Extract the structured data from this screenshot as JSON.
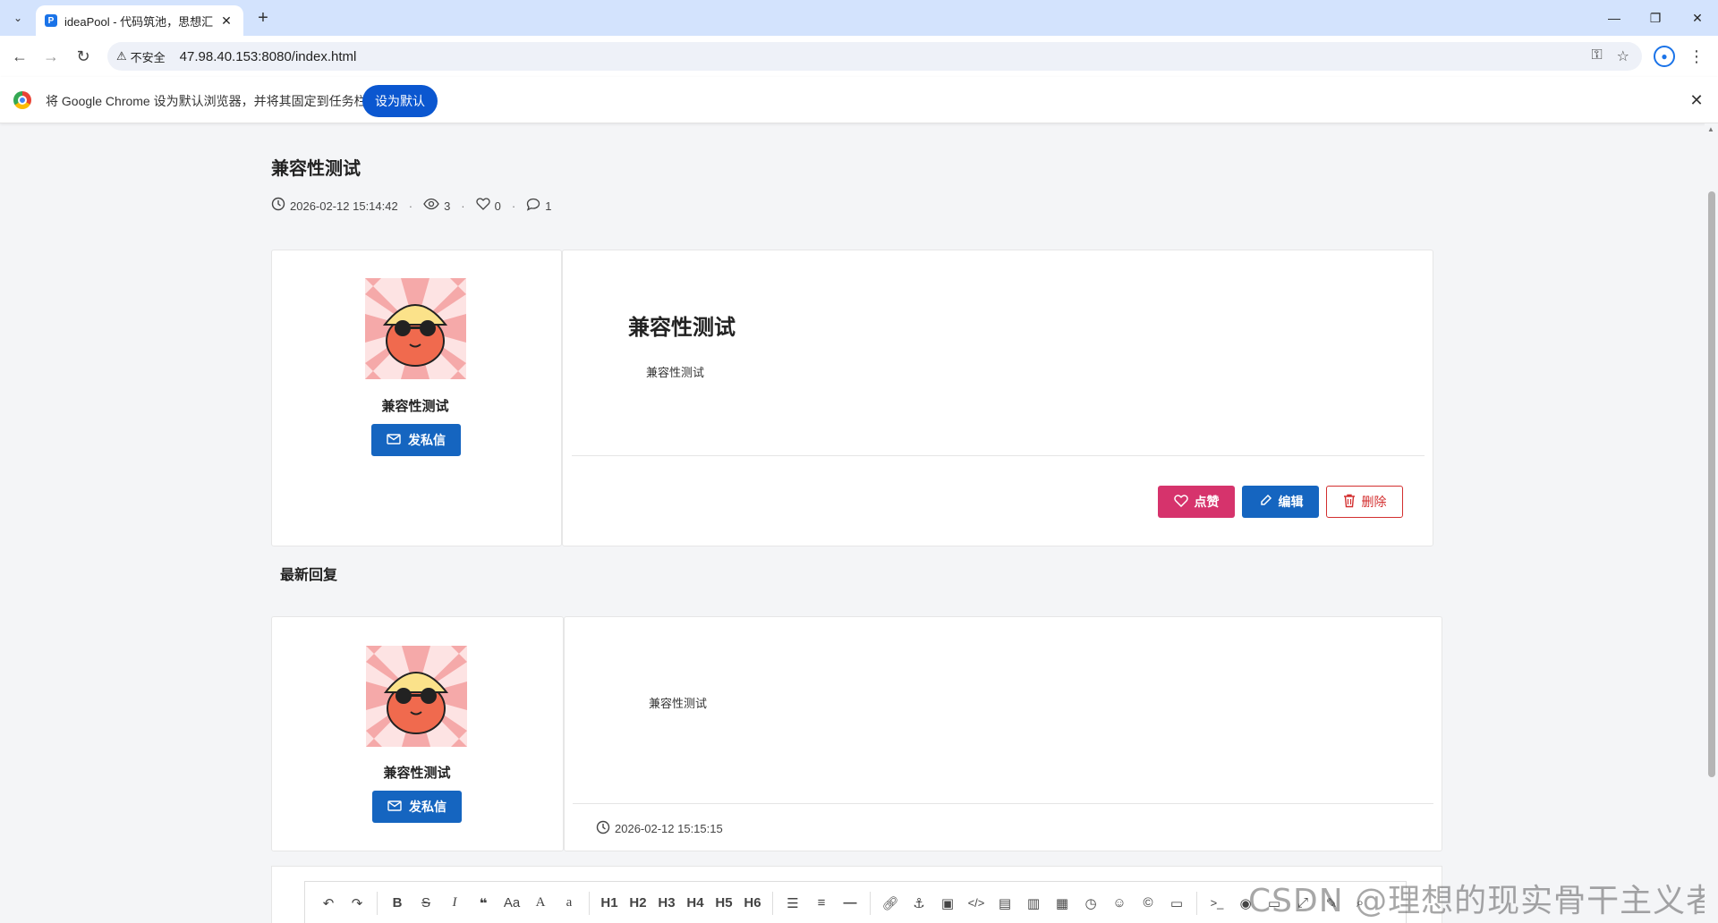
{
  "browser": {
    "tab_title": "ideaPool - 代码筑池，思想汇",
    "url": "47.98.40.153:8080/index.html",
    "insecure_label": "不安全",
    "infobar_text": "将 Google Chrome 设为默认浏览器，并将其固定到任务栏",
    "infobar_button": "设为默认"
  },
  "post": {
    "title": "兼容性测试",
    "datetime": "2026-02-12 15:14:42",
    "views": "3",
    "likes": "0",
    "comments": "1",
    "heading": "兼容性测试",
    "body": "兼容性测试",
    "author": "兼容性测试",
    "pm_label": "发私信",
    "like_label": "点赞",
    "edit_label": "编辑",
    "delete_label": "删除"
  },
  "replies": {
    "title": "最新回复",
    "items": [
      {
        "author": "兼容性测试",
        "pm_label": "发私信",
        "body": "兼容性测试",
        "datetime": "2026-02-12 15:15:15"
      }
    ]
  },
  "editor": {
    "headings": [
      "H1",
      "H2",
      "H3",
      "H4",
      "H5",
      "H6"
    ],
    "case_label": "Aa",
    "upper_label": "A",
    "lower_label": "a"
  },
  "watermark": "CSDN @理想的现实骨干主义者",
  "colors": {
    "primary": "#1565c0",
    "like": "#d6336c",
    "danger": "#d32f2f",
    "tabbar": "#d3e3fd"
  }
}
